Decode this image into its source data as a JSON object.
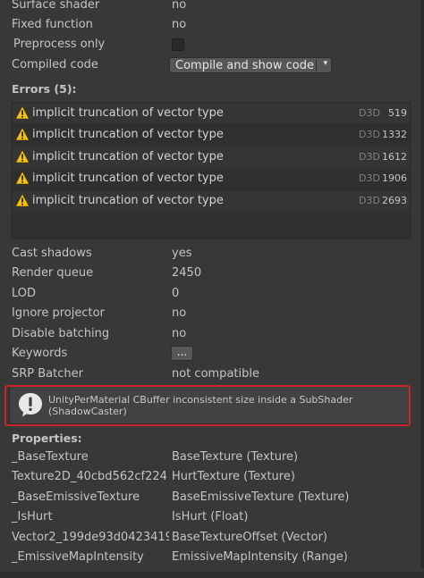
{
  "top_rows": [
    {
      "label": "Surface shader",
      "value": "no"
    },
    {
      "label": "Fixed function",
      "value": "no"
    }
  ],
  "preprocess": {
    "label": "Preprocess only",
    "checked": false
  },
  "compiled": {
    "label": "Compiled code",
    "button": "Compile and show code",
    "arrow": "▾"
  },
  "errors": {
    "header": "Errors (5):",
    "items": [
      {
        "message": "implicit truncation of vector type",
        "platform": "D3D",
        "line": "519"
      },
      {
        "message": "implicit truncation of vector type",
        "platform": "D3D",
        "line": "1332"
      },
      {
        "message": "implicit truncation of vector type",
        "platform": "D3D",
        "line": "1612"
      },
      {
        "message": "implicit truncation of vector type",
        "platform": "D3D",
        "line": "1906"
      },
      {
        "message": "implicit truncation of vector type",
        "platform": "D3D",
        "line": "2693"
      }
    ]
  },
  "props": [
    {
      "label": "Cast shadows",
      "value": "yes"
    },
    {
      "label": "Render queue",
      "value": "2450"
    },
    {
      "label": "LOD",
      "value": "0"
    },
    {
      "label": "Ignore projector",
      "value": "no"
    },
    {
      "label": "Disable batching",
      "value": "no"
    }
  ],
  "keywords": {
    "label": "Keywords",
    "button": "..."
  },
  "srp": {
    "label": "SRP Batcher",
    "value": "not compatible"
  },
  "help": {
    "line1": "UnityPerMaterial CBuffer inconsistent size inside a SubShader",
    "line2": "(ShadowCaster)"
  },
  "properties": {
    "header": "Properties:",
    "items": [
      {
        "name": "_BaseTexture",
        "value": "BaseTexture (Texture)"
      },
      {
        "name": "Texture2D_40cbd562cf224",
        "value": "HurtTexture (Texture)"
      },
      {
        "name": "_BaseEmissiveTexture",
        "value": "BaseEmissiveTexture (Texture)"
      },
      {
        "name": "_IsHurt",
        "value": "IsHurt (Float)"
      },
      {
        "name": "Vector2_199de93d0423419",
        "value": "BaseTextureOffset (Vector)"
      },
      {
        "name": "_EmissiveMapIntensity",
        "value": "EmissiveMapIntensity (Range)"
      }
    ]
  },
  "colors": {
    "background": "#383838",
    "warning": "#f2c00f",
    "highlight_frame": "#c8252f"
  }
}
